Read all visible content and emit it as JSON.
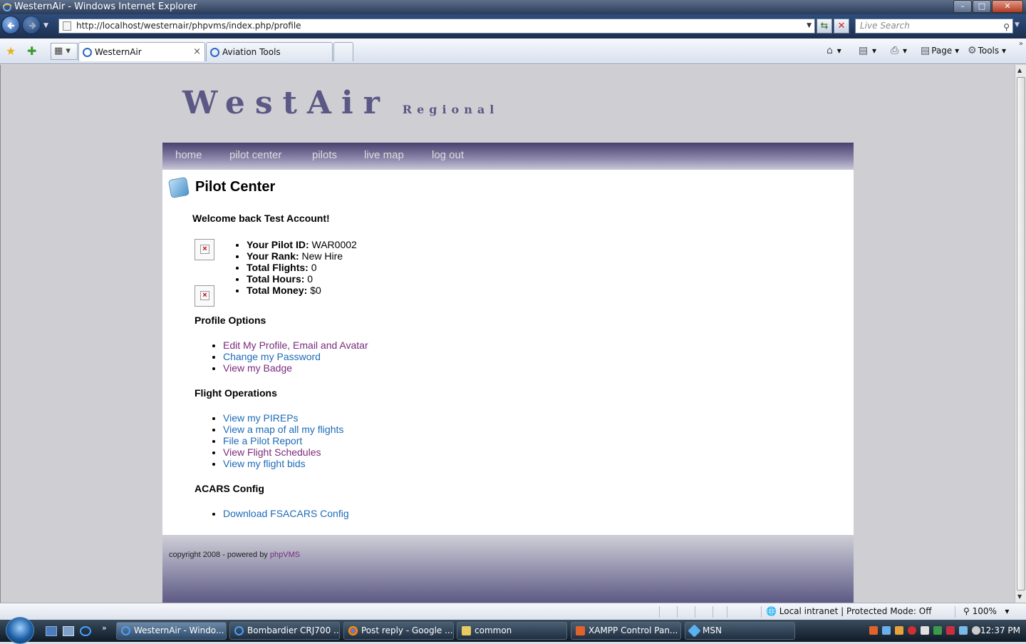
{
  "window": {
    "title": "WesternAir - Windows Internet Explorer"
  },
  "browser": {
    "url": "http://localhost/westernair/phpvms/index.php/profile",
    "search_placeholder": "Live Search",
    "tabs": [
      {
        "label": "WesternAir",
        "active": true
      },
      {
        "label": "Aviation Tools",
        "active": false
      }
    ],
    "commands": {
      "page": "Page",
      "tools": "Tools"
    }
  },
  "site": {
    "logo_main": "WestAir",
    "logo_sub": "Regional",
    "menu": [
      "home",
      "pilot center",
      "pilots",
      "live map",
      "log out"
    ],
    "page_title": "Pilot Center",
    "welcome": "Welcome back Test Account!",
    "pilot_info": [
      {
        "label": "Your Pilot ID:",
        "value": "WAR0002"
      },
      {
        "label": "Your Rank:",
        "value": "New Hire"
      },
      {
        "label": "Total Flights:",
        "value": "0"
      },
      {
        "label": "Total Hours:",
        "value": "0"
      },
      {
        "label": "Total Money:",
        "value": "$0"
      }
    ],
    "profile_options": {
      "heading": "Profile Options",
      "links": [
        "Edit My Profile, Email and Avatar",
        "Change my Password",
        "View my Badge"
      ]
    },
    "flight_operations": {
      "heading": "Flight Operations",
      "links": [
        "View my PIREPs",
        "View a map of all my flights",
        "File a Pilot Report",
        "View Flight Schedules",
        "View my flight bids"
      ]
    },
    "acars": {
      "heading": "ACARS Config",
      "links": [
        "Download FSACARS Config"
      ]
    },
    "footer": {
      "text": "copyright 2008 - powered by",
      "link": "phpVMS"
    }
  },
  "statusbar": {
    "zone": "Local intranet | Protected Mode: Off",
    "zoom": "100%"
  },
  "taskbar": {
    "buttons": [
      "WesternAir - Windo...",
      "Bombardier CRJ700 ...",
      "Post reply - Google ...",
      "common",
      "XAMPP Control Pan...",
      "MSN"
    ],
    "clock": "12:37 PM"
  },
  "colors": {
    "link": "#1d6bb8",
    "visited": "#7a2a7e",
    "menu_dark": "#48416f",
    "logo": "#5c5886"
  }
}
